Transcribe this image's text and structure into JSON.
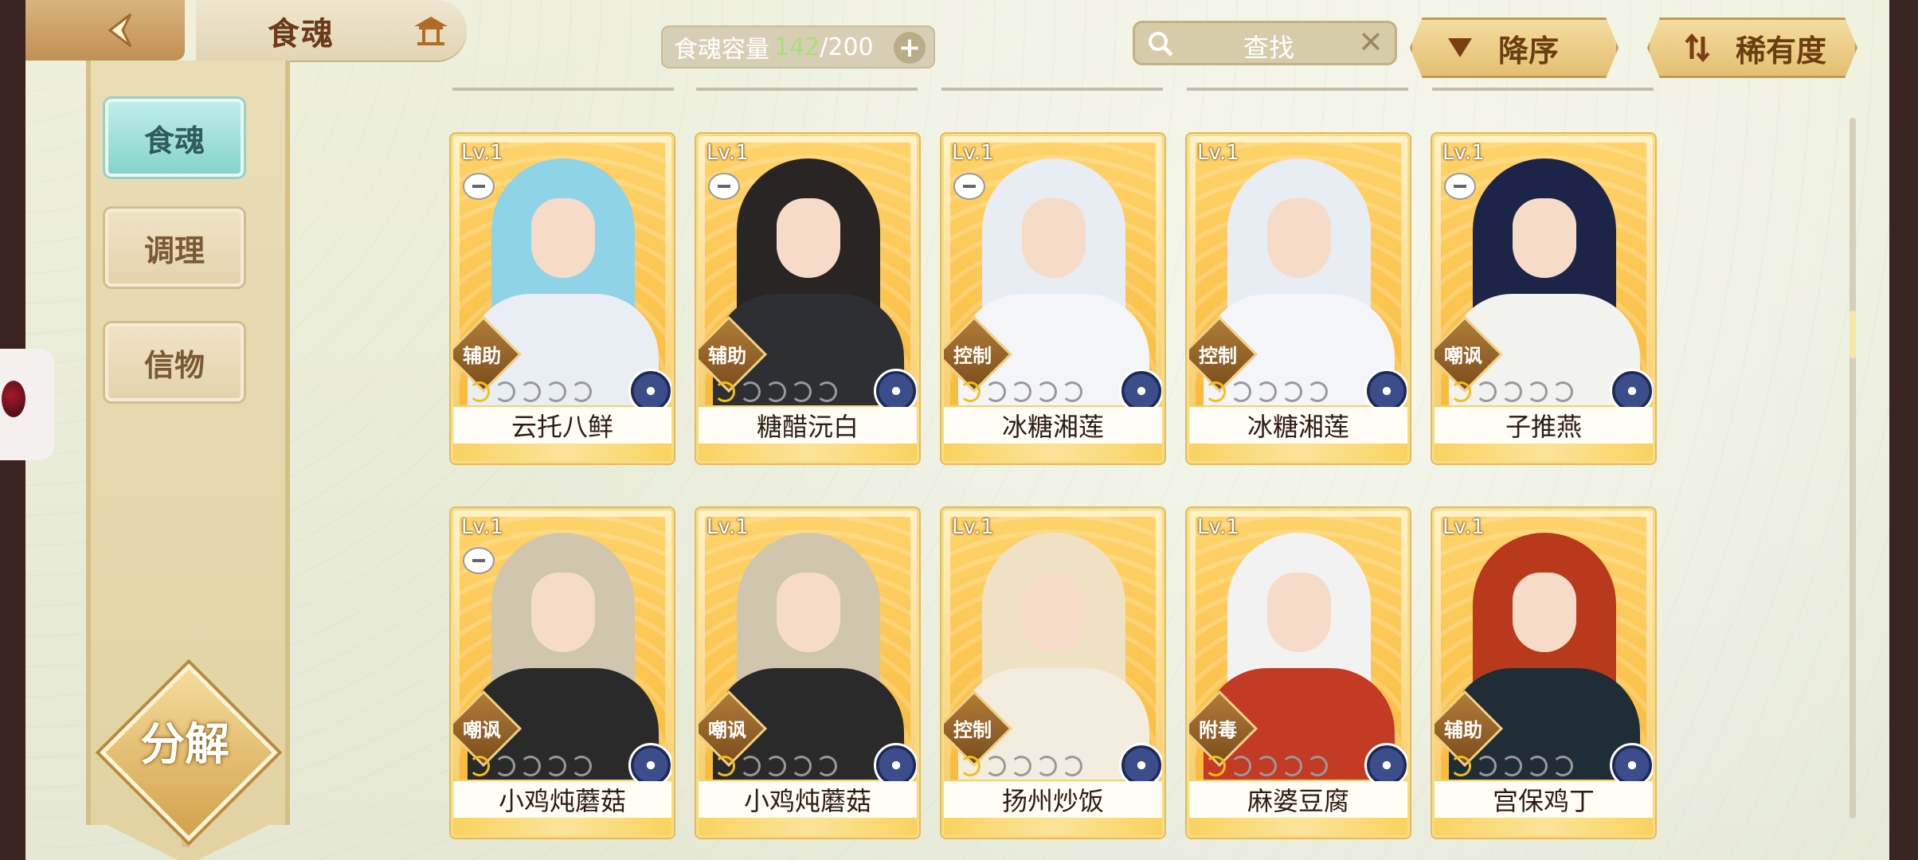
{
  "header": {
    "title": "食魂",
    "capacity_label": "食魂容量",
    "capacity_current": "142",
    "capacity_max": "/200",
    "search_label": "查找",
    "sort_order": "降序",
    "sort_by": "稀有度"
  },
  "sidebar": {
    "tabs": [
      {
        "label": "食魂"
      },
      {
        "label": "调理"
      },
      {
        "label": "信物"
      }
    ],
    "decompose_label": "分解"
  },
  "cards": [
    {
      "level": "Lv.1",
      "role": "辅助",
      "name": "云托八鲜",
      "locked": true,
      "hair": "#8fd3e6",
      "robe": "#e9eef4",
      "stars_on": 1
    },
    {
      "level": "Lv.1",
      "role": "辅助",
      "name": "糖醋沅白",
      "locked": true,
      "hair": "#2a2525",
      "robe": "#2d2f33",
      "stars_on": 1
    },
    {
      "level": "Lv.1",
      "role": "控制",
      "name": "冰糖湘莲",
      "locked": true,
      "hair": "#e8ecf3",
      "robe": "#f3f5f8",
      "stars_on": 1
    },
    {
      "level": "Lv.1",
      "role": "控制",
      "name": "冰糖湘莲",
      "locked": false,
      "hair": "#e8ecf3",
      "robe": "#f3f5f8",
      "stars_on": 1
    },
    {
      "level": "Lv.1",
      "role": "嘲讽",
      "name": "子推燕",
      "locked": true,
      "hair": "#1c2547",
      "robe": "#f2f2ee",
      "stars_on": 1
    },
    {
      "level": "Lv.1",
      "role": "嘲讽",
      "name": "小鸡炖蘑菇",
      "locked": true,
      "hair": "#cfc6ad",
      "robe": "#2a2a2a",
      "stars_on": 1
    },
    {
      "level": "Lv.1",
      "role": "嘲讽",
      "name": "小鸡炖蘑菇",
      "locked": false,
      "hair": "#cfc6ad",
      "robe": "#2a2a2a",
      "stars_on": 1
    },
    {
      "level": "Lv.1",
      "role": "控制",
      "name": "扬州炒饭",
      "locked": false,
      "hair": "#efe2c4",
      "robe": "#f3ede0",
      "stars_on": 1
    },
    {
      "level": "Lv.1",
      "role": "附毒",
      "name": "麻婆豆腐",
      "locked": false,
      "hair": "#f2f2f2",
      "robe": "#c33a25",
      "stars_on": 1
    },
    {
      "level": "Lv.1",
      "role": "辅助",
      "name": "宫保鸡丁",
      "locked": false,
      "hair": "#b8391c",
      "robe": "#1f2d36",
      "stars_on": 1
    }
  ],
  "colors": {
    "accent_teal": "#86d3cc",
    "card_gold": "#f5c860",
    "capacity_green": "#a6e07a"
  }
}
